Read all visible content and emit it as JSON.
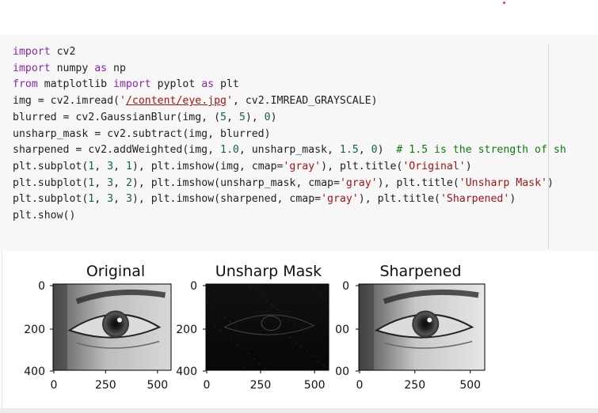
{
  "code": {
    "lines": [
      [
        {
          "t": "import",
          "c": "kw"
        },
        {
          "t": " cv2"
        }
      ],
      [
        {
          "t": "import",
          "c": "kw"
        },
        {
          "t": " numpy "
        },
        {
          "t": "as",
          "c": "kw"
        },
        {
          "t": " np"
        }
      ],
      [
        {
          "t": "from",
          "c": "kw"
        },
        {
          "t": " matplotlib "
        },
        {
          "t": "import",
          "c": "kw"
        },
        {
          "t": " pyplot "
        },
        {
          "t": "as",
          "c": "kw"
        },
        {
          "t": " plt"
        }
      ],
      [
        {
          "t": "img = cv2.imread("
        },
        {
          "t": "'",
          "c": "str"
        },
        {
          "t": "/content/eye.jpg",
          "c": "str path"
        },
        {
          "t": "'",
          "c": "str"
        },
        {
          "t": ", cv2.IMREAD_GRAYSCALE)"
        }
      ],
      [
        {
          "t": "blurred = cv2.GaussianBlur(img, ("
        },
        {
          "t": "5",
          "c": "num"
        },
        {
          "t": ", "
        },
        {
          "t": "5",
          "c": "num"
        },
        {
          "t": "), "
        },
        {
          "t": "0",
          "c": "num"
        },
        {
          "t": ")"
        }
      ],
      [
        {
          "t": "unsharp_mask = cv2.subtract(img, blurred)"
        }
      ],
      [
        {
          "t": "sharpened = cv2.addWeighted(img, "
        },
        {
          "t": "1.0",
          "c": "num"
        },
        {
          "t": ", unsharp_mask, "
        },
        {
          "t": "1.5",
          "c": "num"
        },
        {
          "t": ", "
        },
        {
          "t": "0",
          "c": "num"
        },
        {
          "t": ")  "
        },
        {
          "t": "# 1.5 is the strength of sh",
          "c": "cmt"
        }
      ],
      [
        {
          "t": "plt.subplot("
        },
        {
          "t": "1",
          "c": "num"
        },
        {
          "t": ", "
        },
        {
          "t": "3",
          "c": "num"
        },
        {
          "t": ", "
        },
        {
          "t": "1",
          "c": "num"
        },
        {
          "t": "), plt.imshow(img, cmap="
        },
        {
          "t": "'gray'",
          "c": "str"
        },
        {
          "t": "), plt.title("
        },
        {
          "t": "'Original'",
          "c": "str"
        },
        {
          "t": ")"
        }
      ],
      [
        {
          "t": "plt.subplot("
        },
        {
          "t": "1",
          "c": "num"
        },
        {
          "t": ", "
        },
        {
          "t": "3",
          "c": "num"
        },
        {
          "t": ", "
        },
        {
          "t": "2",
          "c": "num"
        },
        {
          "t": "), plt.imshow(unsharp_mask, cmap="
        },
        {
          "t": "'gray'",
          "c": "str"
        },
        {
          "t": "), plt.title("
        },
        {
          "t": "'Unsharp Mask'",
          "c": "str"
        },
        {
          "t": ")"
        }
      ],
      [
        {
          "t": "plt.subplot("
        },
        {
          "t": "1",
          "c": "num"
        },
        {
          "t": ", "
        },
        {
          "t": "3",
          "c": "num"
        },
        {
          "t": ", "
        },
        {
          "t": "3",
          "c": "num"
        },
        {
          "t": "), plt.imshow(sharpened, cmap="
        },
        {
          "t": "'gray'",
          "c": "str"
        },
        {
          "t": "), plt.title("
        },
        {
          "t": "'Sharpened'",
          "c": "str"
        },
        {
          "t": ")"
        }
      ],
      [
        {
          "t": "plt.show()"
        }
      ]
    ]
  },
  "output": {
    "panels": [
      {
        "title": "Original",
        "y_ticks": [
          "0",
          "200",
          "400"
        ],
        "x_ticks": [
          "0",
          "250",
          "500"
        ],
        "image": "bright"
      },
      {
        "title": "Unsharp Mask",
        "y_ticks": [
          "0",
          "200",
          "400"
        ],
        "x_ticks": [
          "0",
          "250",
          "500"
        ],
        "image": "dark"
      },
      {
        "title": "Sharpened",
        "y_ticks": [
          "0",
          "00",
          "00"
        ],
        "x_ticks": [
          "0",
          "250",
          "500"
        ],
        "image": "sharp"
      }
    ]
  },
  "colors": {
    "keyword": "#8e24aa",
    "string": "#a31515",
    "number": "#116644",
    "comment": "#0f7b0f",
    "cell_background": "#f7f7f7"
  }
}
